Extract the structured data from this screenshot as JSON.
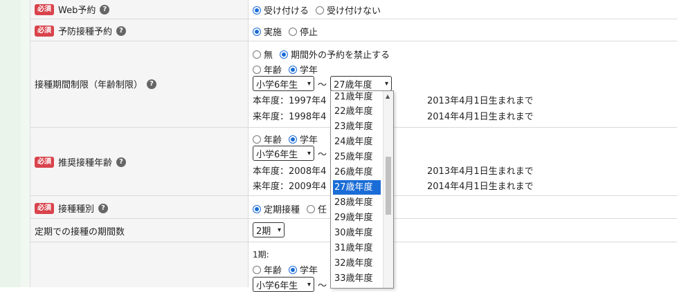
{
  "rows": {
    "web": {
      "label": "Web予約",
      "required": "必須",
      "options": [
        "受け付ける",
        "受け付けない"
      ]
    },
    "vaccine": {
      "label": "予防接種予約",
      "required": "必須",
      "options": [
        "実施",
        "停止"
      ]
    },
    "period": {
      "label": "接種期間制限（年齢制限）",
      "opts1": [
        "無",
        "期間外の予約を禁止する"
      ],
      "opts2": [
        "年齢",
        "学年"
      ],
      "from": "小学6年生",
      "tilde": "〜",
      "to": "27歳年度",
      "this_year_left": "本年度：1997年4",
      "this_year_right": "2013年4月1日生まれまで",
      "next_year_left": "来年度：1998年4",
      "next_year_right": "2014年4月1日生まれまで"
    },
    "recommend": {
      "label": "推奨接種年齢",
      "required": "必須",
      "opts": [
        "年齢",
        "学年"
      ],
      "from": "小学6年生",
      "tilde": "〜",
      "this_year_left": "本年度：2008年4",
      "this_year_right": "2013年4月1日生まれまで",
      "next_year_left": "来年度：2009年4",
      "next_year_right": "2014年4月1日生まれまで"
    },
    "type": {
      "label": "接種種別",
      "required": "必須",
      "options": [
        "定期接種",
        "任"
      ]
    },
    "count": {
      "label": "定期での接種の期間数",
      "value": "2期"
    },
    "last": {
      "label": "",
      "period_label": "1期:",
      "opts": [
        "年齢",
        "学年"
      ],
      "from": "小学6年生",
      "tilde": "〜"
    }
  },
  "dropdown": {
    "items": [
      "21歳年度",
      "22歳年度",
      "23歳年度",
      "24歳年度",
      "25歳年度",
      "26歳年度",
      "27歳年度",
      "28歳年度",
      "29歳年度",
      "30歳年度",
      "31歳年度",
      "32歳年度",
      "33歳年度"
    ],
    "selected": "27歳年度"
  }
}
